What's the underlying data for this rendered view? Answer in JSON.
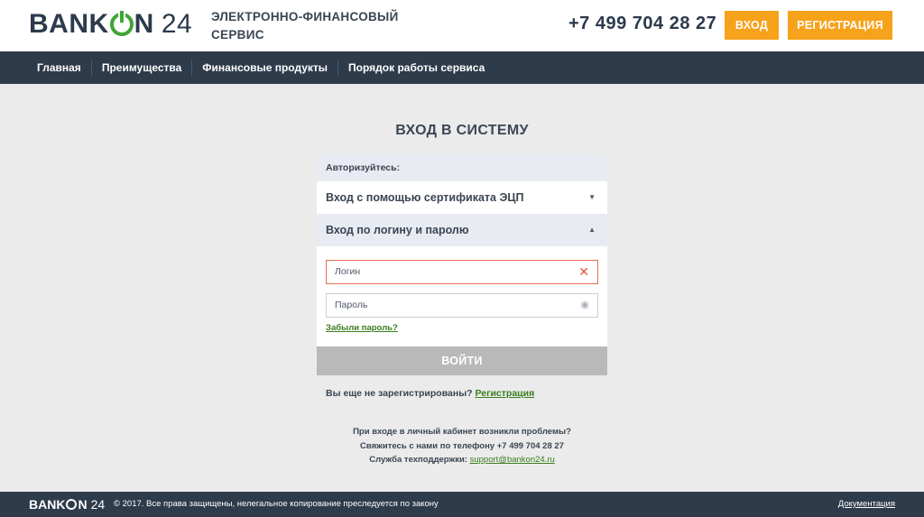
{
  "header": {
    "logo_prefix": "BANK",
    "logo_letter": "N",
    "logo_number": "24",
    "tagline": "ЭЛЕКТРОННО-ФИНАНСОВЫЙ СЕРВИС",
    "phone": "+7 499 704 28 27",
    "login_label": "ВХОД",
    "register_label": "РЕГИСТРАЦИЯ"
  },
  "nav": {
    "items": [
      {
        "label": "Главная"
      },
      {
        "label": "Преимущества"
      },
      {
        "label": "Финансовые продукты"
      },
      {
        "label": "Порядок работы сервиса"
      }
    ]
  },
  "main": {
    "title": "ВХОД В СИСТЕМУ",
    "auth_label": "Авторизуйтесь:",
    "cert_option": "Вход с помощью сертификата ЭЦП",
    "login_option": "Вход по логину и паролю",
    "login_placeholder": "Логин",
    "login_value": "",
    "password_placeholder": "Пароль",
    "password_value": "",
    "forgot_label": "Забыли пароль?",
    "submit_label": "ВОЙТИ",
    "not_registered": "Вы еще не зарегистрированы?",
    "register_link": "Регистрация"
  },
  "help": {
    "line1": "При входе в личный кабинет возникли проблемы?",
    "line2": "Свяжитесь с нами по телефону +7 499 704 28 27",
    "line3_prefix": "Служба техподдержки:",
    "support_email": "support@bankon24.ru"
  },
  "footer": {
    "logo_prefix": "BANK",
    "logo_letter": "N",
    "logo_number": "24",
    "copyright": "© 2017. Все права защищены, нелегальное копирование преследуется по закону",
    "docs_label": "Документация"
  },
  "colors": {
    "brand_navy": "#2e3b4b",
    "brand_green": "#3fa535",
    "accent_orange": "#f7a21b",
    "error_red": "#e0543c"
  },
  "icons": {
    "logo_o": "power-icon",
    "cert_caret": "caret-down-icon",
    "login_caret": "caret-up-icon",
    "login_clear": "clear-icon",
    "password_toggle": "eye-icon"
  }
}
